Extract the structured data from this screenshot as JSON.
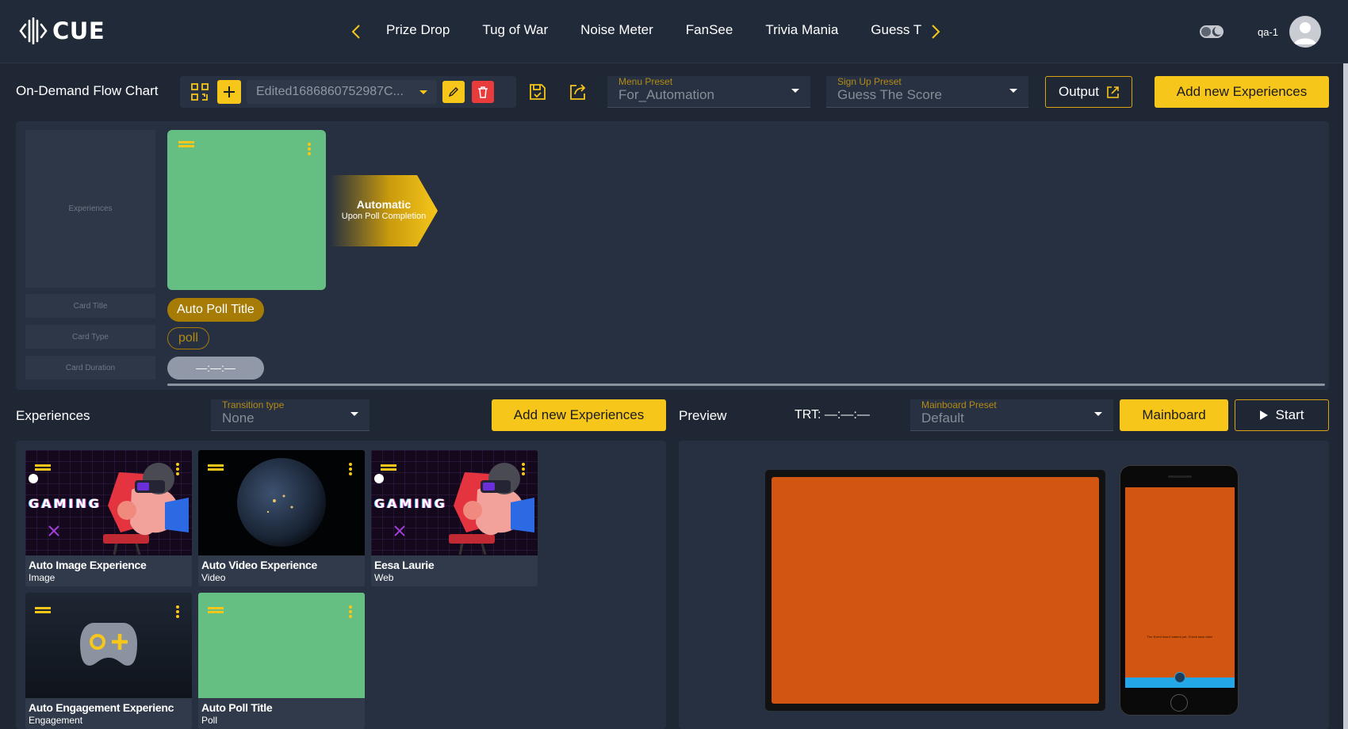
{
  "header": {
    "logo_text": "CUE",
    "nav_items": [
      "Prize Drop",
      "Tug of War",
      "Noise Meter",
      "FanSee",
      "Trivia Mania",
      "Guess T"
    ],
    "user_name": "qa-1"
  },
  "toolbar": {
    "page_title": "On-Demand Flow Chart",
    "flow_name": "Edited1686860752987C...",
    "menu_preset": {
      "label": "Menu Preset",
      "value": "For_Automation"
    },
    "signup_preset": {
      "label": "Sign Up Preset",
      "value": "Guess The Score"
    },
    "output_label": "Output",
    "add_experiences_label": "Add new Experiences"
  },
  "flow": {
    "row_labels": [
      "Experiences",
      "Card Title",
      "Card Type",
      "Card Duration"
    ],
    "card_title": "Auto Poll Title",
    "card_type": "poll",
    "card_duration": "—:—:—",
    "transition_title": "Automatic",
    "transition_subtitle": "Upon Poll Completion"
  },
  "experiences": {
    "title": "Experiences",
    "transition_type": {
      "label": "Transition type",
      "value": "None"
    },
    "add_label": "Add new Experiences",
    "gaming_word": "GAMING",
    "cards": [
      {
        "name": "Auto Image Experience",
        "type": "Image"
      },
      {
        "name": "Auto Video Experience",
        "type": "Video"
      },
      {
        "name": "Eesa Laurie",
        "type": "Web"
      },
      {
        "name": "Auto Engagement Experienc",
        "type": "Engagement"
      },
      {
        "name": "Auto Poll Title",
        "type": "Poll"
      }
    ]
  },
  "preview": {
    "title": "Preview",
    "trt": "TRT: —:—:—",
    "mainboard_preset": {
      "label": "Mainboard Preset",
      "value": "Default"
    },
    "mainboard_label": "Mainboard",
    "start_label": "Start",
    "phone_message": "The Event hasn't started yet. Check back later!"
  },
  "colors": {
    "accent": "#f6c61a",
    "card_green": "#66bf82",
    "preview_orange": "#d35512",
    "background": "#1f2735"
  }
}
